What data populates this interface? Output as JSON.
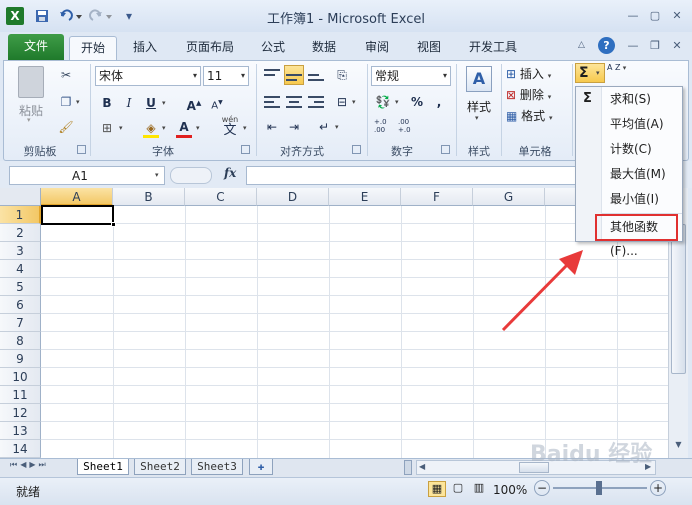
{
  "window": {
    "title": "工作簿1 - Microsoft Excel"
  },
  "qat": {
    "app_icon": "X",
    "save_icon": "save-icon",
    "undo_icon": "undo-icon",
    "redo_icon": "redo-icon",
    "customize": "▾"
  },
  "tabs": [
    "文件",
    "开始",
    "插入",
    "页面布局",
    "公式",
    "数据",
    "审阅",
    "视图",
    "开发工具"
  ],
  "groups": {
    "clipboard": "剪贴板",
    "font": "字体",
    "align": "对齐方式",
    "number": "数字",
    "styles": "样式",
    "cells": "单元格"
  },
  "clipboard": {
    "paste": "粘贴"
  },
  "font": {
    "name": "宋体",
    "size": "11",
    "bold": "B",
    "italic": "I",
    "underline": "U",
    "grow": "A",
    "shrink": "A",
    "fontcolor": "A",
    "wen": "wén",
    "wen2": "文"
  },
  "number": {
    "format": "常规",
    "percent": "%",
    "comma": ",",
    "inc": "+.0\n.00",
    "dec": ".00\n+.0"
  },
  "styles": {
    "label": "样式"
  },
  "cells": {
    "insert": "插入",
    "delete": "删除",
    "format": "格式"
  },
  "editing": {
    "sum_symbol": "Σ",
    "sort": "A Z"
  },
  "sum_menu": {
    "items": [
      "求和(S)",
      "平均值(A)",
      "计数(C)",
      "最大值(M)",
      "最小值(I)",
      "其他函数(F)..."
    ],
    "highlighted": "其他函数(F)..."
  },
  "formula_bar": {
    "namebox": "A1",
    "fx": "fx",
    "value": ""
  },
  "columns": [
    "A",
    "B",
    "C",
    "D",
    "E",
    "F",
    "G"
  ],
  "rows": [
    "1",
    "2",
    "3",
    "4",
    "5",
    "6",
    "7",
    "8",
    "9",
    "10",
    "11",
    "12",
    "13",
    "14"
  ],
  "sheets": [
    "Sheet1",
    "Sheet2",
    "Sheet3"
  ],
  "status": {
    "ready": "就绪",
    "zoom": "100%",
    "minus": "−",
    "plus": "+"
  },
  "watermark": "Baidu 经验",
  "colors": {
    "file_tab": "#2a8a35",
    "accent_red": "#e03030",
    "selection": "#000000"
  }
}
